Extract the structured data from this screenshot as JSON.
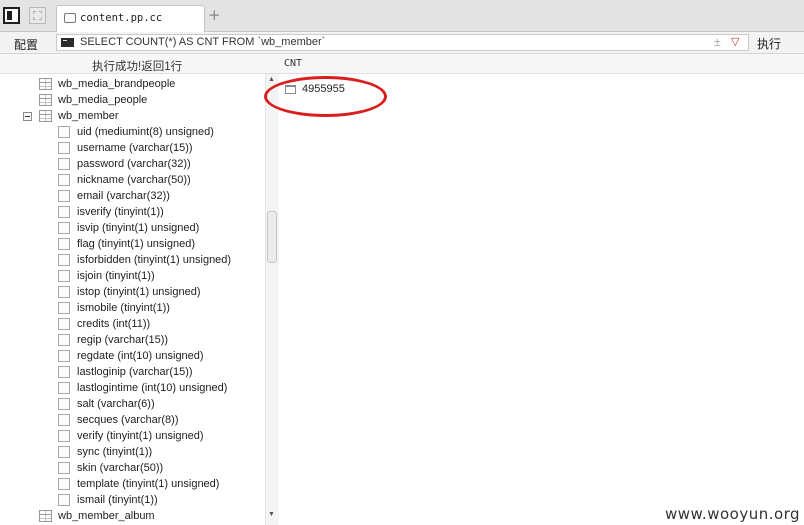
{
  "tabbar": {
    "tab_title": "content.pp.cc",
    "add_tab": "+"
  },
  "querybar": {
    "config_label": "配置",
    "query": "SELECT COUNT(*) AS CNT FROM `wb_member`",
    "pin": "±",
    "dropdown": "▽",
    "run_label": "执行"
  },
  "status": {
    "message": "执行成功!返回1行",
    "column_header": "CNT"
  },
  "tree": {
    "tables_top": [
      "wb_media_brandpeople",
      "wb_media_people"
    ],
    "expanded_table": "wb_member",
    "columns": [
      "uid (mediumint(8) unsigned)",
      "username (varchar(15))",
      "password (varchar(32))",
      "nickname (varchar(50))",
      "email (varchar(32))",
      "isverify (tinyint(1))",
      "isvip (tinyint(1) unsigned)",
      "flag (tinyint(1) unsigned)",
      "isforbidden (tinyint(1) unsigned)",
      "isjoin (tinyint(1))",
      "istop (tinyint(1) unsigned)",
      "ismobile (tinyint(1))",
      "credits (int(11))",
      "regip (varchar(15))",
      "regdate (int(10) unsigned)",
      "lastloginip (varchar(15))",
      "lastlogintime (int(10) unsigned)",
      "salt (varchar(6))",
      "secques (varchar(8))",
      "verify (tinyint(1) unsigned)",
      "sync (tinyint(1))",
      "skin (varchar(50))",
      "template (tinyint(1) unsigned)",
      "ismail (tinyint(1))"
    ],
    "tables_bottom": [
      "wb_member_album"
    ]
  },
  "result": {
    "value": "4955955"
  },
  "watermark": "www.wooyun.org",
  "colors": {
    "highlight": "#d91e1e",
    "tabbar_bg": "#e4e4e4"
  }
}
